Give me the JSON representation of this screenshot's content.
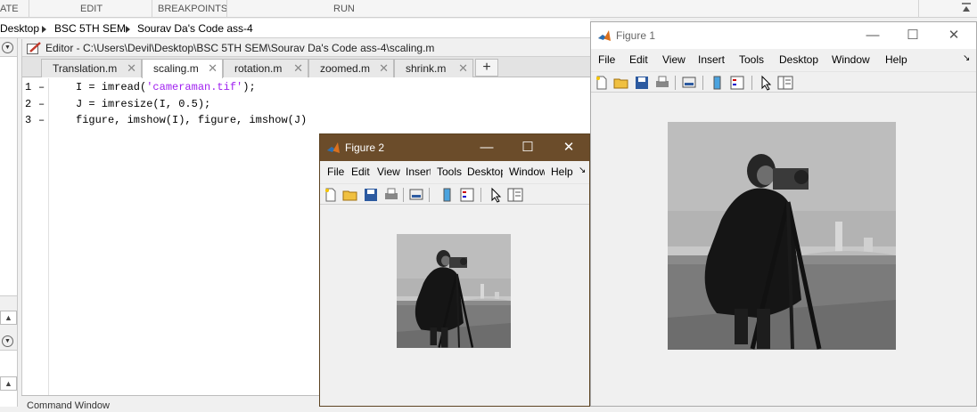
{
  "ribbon": {
    "sections": [
      "ATE",
      "EDIT",
      "BREAKPOINTS",
      "RUN"
    ]
  },
  "breadcrumb": [
    "Desktop",
    "BSC 5TH SEM",
    "Sourav Da's Code ass-4"
  ],
  "editor": {
    "title": "Editor - C:\\Users\\Devil\\Desktop\\BSC 5TH SEM\\Sourav Da's Code ass-4\\scaling.m",
    "tabs": [
      {
        "label": "Translation.m",
        "active": false
      },
      {
        "label": "scaling.m",
        "active": true
      },
      {
        "label": "rotation.m",
        "active": false
      },
      {
        "label": "zoomed.m",
        "active": false
      },
      {
        "label": "shrink.m",
        "active": false
      }
    ],
    "tab_close": "✕",
    "add_tab": "+",
    "lines": [
      {
        "num": "1",
        "mark": "–",
        "pre": "I = imread(",
        "str": "'cameraman.tif'",
        "post": ");"
      },
      {
        "num": "2",
        "mark": "–",
        "pre": "J = imresize(I, 0.5);",
        "str": "",
        "post": ""
      },
      {
        "num": "3",
        "mark": "–",
        "pre": "figure, imshow(I), figure, imshow(J)",
        "str": "",
        "post": ""
      }
    ]
  },
  "command_window": {
    "label": "Command Window"
  },
  "figure1": {
    "title": "Figure 1",
    "menu": [
      "File",
      "Edit",
      "View",
      "Insert",
      "Tools",
      "Desktop",
      "Window",
      "Help"
    ],
    "titlebar_color": "#ffffff"
  },
  "figure2": {
    "title": "Figure 2",
    "menu": [
      "File",
      "Edit",
      "View",
      "Insert",
      "Tools",
      "Desktop",
      "Window",
      "Help"
    ],
    "titlebar_color": "#6b4c2a"
  },
  "window_controls": {
    "minimize": "—",
    "maximize": "☐",
    "close": "✕"
  },
  "colors": {
    "string": "#a020f0",
    "editor_bg": "#ffffff",
    "chrome": "#f0f0f0"
  }
}
